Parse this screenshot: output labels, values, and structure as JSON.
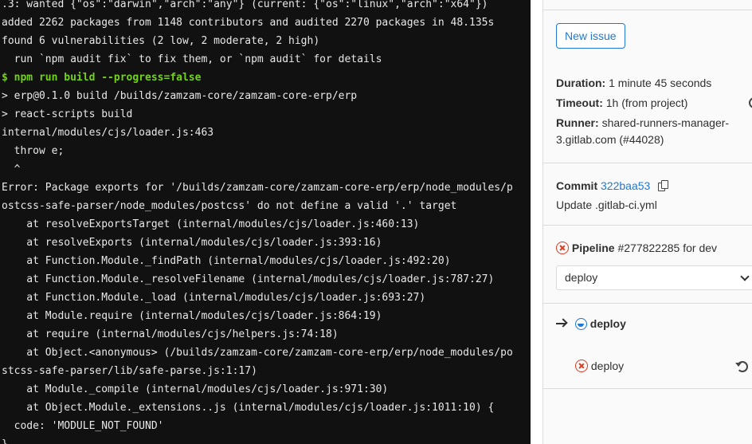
{
  "terminal": {
    "lines": [
      ".3: wanted {\"os\":\"darwin\",\"arch\":\"any\"} (current: {\"os\":\"linux\",\"arch\":\"x64\"})",
      "added 2262 packages from 1148 contributors and audited 2270 packages in 48.135s",
      "found 6 vulnerabilities (2 low, 2 moderate, 2 high)",
      "  run `npm audit fix` to fix them, or `npm audit` for details",
      "$ npm run build --progress=false",
      "> erp@0.1.0 build /builds/zamzam-core/zamzam-core-erp/erp",
      "> react-scripts build",
      "internal/modules/cjs/loader.js:463",
      "  throw e;",
      "  ^",
      "Error: Package exports for '/builds/zamzam-core/zamzam-core-erp/erp/node_modules/p",
      "ostcss-safe-parser/node_modules/postcss' do not define a valid '.' target",
      "    at resolveExportsTarget (internal/modules/cjs/loader.js:460:13)",
      "    at resolveExports (internal/modules/cjs/loader.js:393:16)",
      "    at Function.Module._findPath (internal/modules/cjs/loader.js:492:20)",
      "    at Function.Module._resolveFilename (internal/modules/cjs/loader.js:787:27)",
      "    at Function.Module._load (internal/modules/cjs/loader.js:693:27)",
      "    at Module.require (internal/modules/cjs/loader.js:864:19)",
      "    at require (internal/modules/cjs/helpers.js:74:18)",
      "    at Object.<anonymous> (/builds/zamzam-core/zamzam-core-erp/erp/node_modules/po",
      "stcss-safe-parser/lib/safe-parse.js:1:17)",
      "    at Module._compile (internal/modules/cjs/loader.js:971:30)",
      "    at Object.Module._extensions..js (internal/modules/cjs/loader.js:1011:10) {",
      "  code: 'MODULE_NOT_FOUND'",
      "}"
    ]
  },
  "sidebar": {
    "new_issue_label": "New issue",
    "duration_label": "Duration:",
    "duration_value": "1 minute 45 seconds",
    "timeout_label": "Timeout:",
    "timeout_value": "1h (from project)",
    "runner_label": "Runner:",
    "runner_value_line1": "shared-runners-manager-",
    "runner_value_line2": "3.gitlab.com (#44028)",
    "commit_label": "Commit",
    "commit_sha": "322baa53",
    "commit_message": "Update .gitlab-ci.yml",
    "pipeline_label": "Pipeline",
    "pipeline_id": "#277822285",
    "pipeline_for": "for dev",
    "stage_select_value": "deploy",
    "stage_name": "deploy",
    "job_name": "deploy"
  },
  "colors": {
    "terminal_bg": "#111111",
    "command_green": "#73d216",
    "link_blue": "#1f78d1",
    "failed_red": "#db3b21"
  },
  "icons": [
    "copy-icon",
    "failed-status-icon",
    "running-status-icon",
    "arrow-right-icon",
    "chevron-down-icon",
    "retry-icon",
    "help-icon"
  ]
}
